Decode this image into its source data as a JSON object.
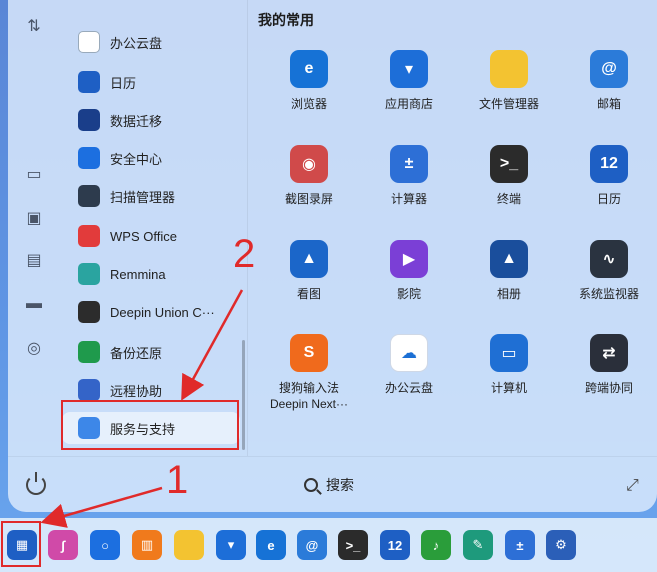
{
  "launcher": {
    "favorites_title": "我的常用",
    "categories": [
      {
        "label": "办公云盘",
        "icon": "cloud-disk-icon",
        "color": "#ffffff"
      },
      {
        "label": "日历",
        "icon": "calendar-icon",
        "color": "#1e5fc4"
      },
      {
        "label": "数据迁移",
        "icon": "data-migration-icon",
        "color": "#1a3e8a"
      },
      {
        "label": "安全中心",
        "icon": "shield-icon",
        "color": "#1c6fe0"
      },
      {
        "label": "扫描管理器",
        "icon": "scanner-icon",
        "color": "#2d3b4d"
      },
      {
        "label": "WPS Office",
        "icon": "wps-icon",
        "color": "#e23b3b"
      },
      {
        "label": "Remmina",
        "icon": "remmina-icon",
        "color": "#2aa4a0"
      },
      {
        "label": "Deepin Union C···",
        "icon": "deepin-union-icon",
        "color": "#2c2c2c"
      },
      {
        "label": "备份还原",
        "icon": "backup-icon",
        "color": "#1f9a4c"
      },
      {
        "label": "远程协助",
        "icon": "remote-assist-icon",
        "color": "#3464c8"
      },
      {
        "label": "服务与支持",
        "icon": "service-support-icon",
        "color": "#3d87e8"
      }
    ],
    "apps": [
      {
        "label": "浏览器",
        "icon": "browser-icon",
        "color": "#1672d6",
        "glyph": "e"
      },
      {
        "label": "应用商店",
        "icon": "app-store-icon",
        "color": "#1d6ed8",
        "glyph": "▾"
      },
      {
        "label": "文件管理器",
        "icon": "folder-icon",
        "color": "#f3c331",
        "glyph": ""
      },
      {
        "label": "邮箱",
        "icon": "mail-icon",
        "color": "#2b7bd9",
        "glyph": "@"
      },
      {
        "label": "截图录屏",
        "icon": "screenshot-icon",
        "color": "#d04a4a",
        "glyph": "◉"
      },
      {
        "label": "计算器",
        "icon": "calculator-icon",
        "color": "#2d6fd6",
        "glyph": "±"
      },
      {
        "label": "终端",
        "icon": "terminal-icon",
        "color": "#2b2b2b",
        "glyph": ">_"
      },
      {
        "label": "日历",
        "icon": "calendar-icon",
        "color": "#1e5fc4",
        "glyph": "12"
      },
      {
        "label": "看图",
        "icon": "image-viewer-icon",
        "color": "#1b66c9",
        "glyph": "▲"
      },
      {
        "label": "影院",
        "icon": "movie-icon",
        "color": "#7b3fd6",
        "glyph": "▶"
      },
      {
        "label": "相册",
        "icon": "album-icon",
        "color": "#1a4e9c",
        "glyph": "▲"
      },
      {
        "label": "系统监视器",
        "icon": "system-monitor-icon",
        "color": "#2a3340",
        "glyph": "∿"
      },
      {
        "label": "搜狗输入法\nDeepin Next···",
        "icon": "sogou-icon",
        "color": "#f06a1c",
        "glyph": "S"
      },
      {
        "label": "办公云盘",
        "icon": "cloud-disk-icon",
        "color": "#ffffff",
        "glyph": "☁"
      },
      {
        "label": "计算机",
        "icon": "computer-icon",
        "color": "#1f6fd4",
        "glyph": "▭"
      },
      {
        "label": "跨端协同",
        "icon": "cross-device-icon",
        "color": "#2a2f3a",
        "glyph": "⇄"
      }
    ],
    "search_label": "搜索"
  },
  "annotations": {
    "one": "1",
    "two": "2"
  },
  "taskbar": [
    {
      "name": "launcher-icon",
      "color": "#1e5fc4",
      "glyph": "▦"
    },
    {
      "name": "notes-icon",
      "color": "#d04aa8",
      "glyph": "∫"
    },
    {
      "name": "search-icon",
      "color": "#1c6fe0",
      "glyph": "○"
    },
    {
      "name": "multitask-icon",
      "color": "#f07a1c",
      "glyph": "▥"
    },
    {
      "name": "folder-icon",
      "color": "#f3c331",
      "glyph": ""
    },
    {
      "name": "app-store-icon",
      "color": "#1d6ed8",
      "glyph": "▾"
    },
    {
      "name": "browser-icon",
      "color": "#1672d6",
      "glyph": "e"
    },
    {
      "name": "mail-icon",
      "color": "#2b7bd9",
      "glyph": "@"
    },
    {
      "name": "terminal-icon",
      "color": "#2b2b2b",
      "glyph": ">_"
    },
    {
      "name": "calendar-icon",
      "color": "#1e5fc4",
      "glyph": "12"
    },
    {
      "name": "music-icon",
      "color": "#2a9d3a",
      "glyph": "♪"
    },
    {
      "name": "text-editor-icon",
      "color": "#1e9a7c",
      "glyph": "✎"
    },
    {
      "name": "calculator-icon",
      "color": "#2d6fd6",
      "glyph": "±"
    },
    {
      "name": "settings-icon",
      "color": "#2b5fb8",
      "glyph": "⚙"
    }
  ]
}
